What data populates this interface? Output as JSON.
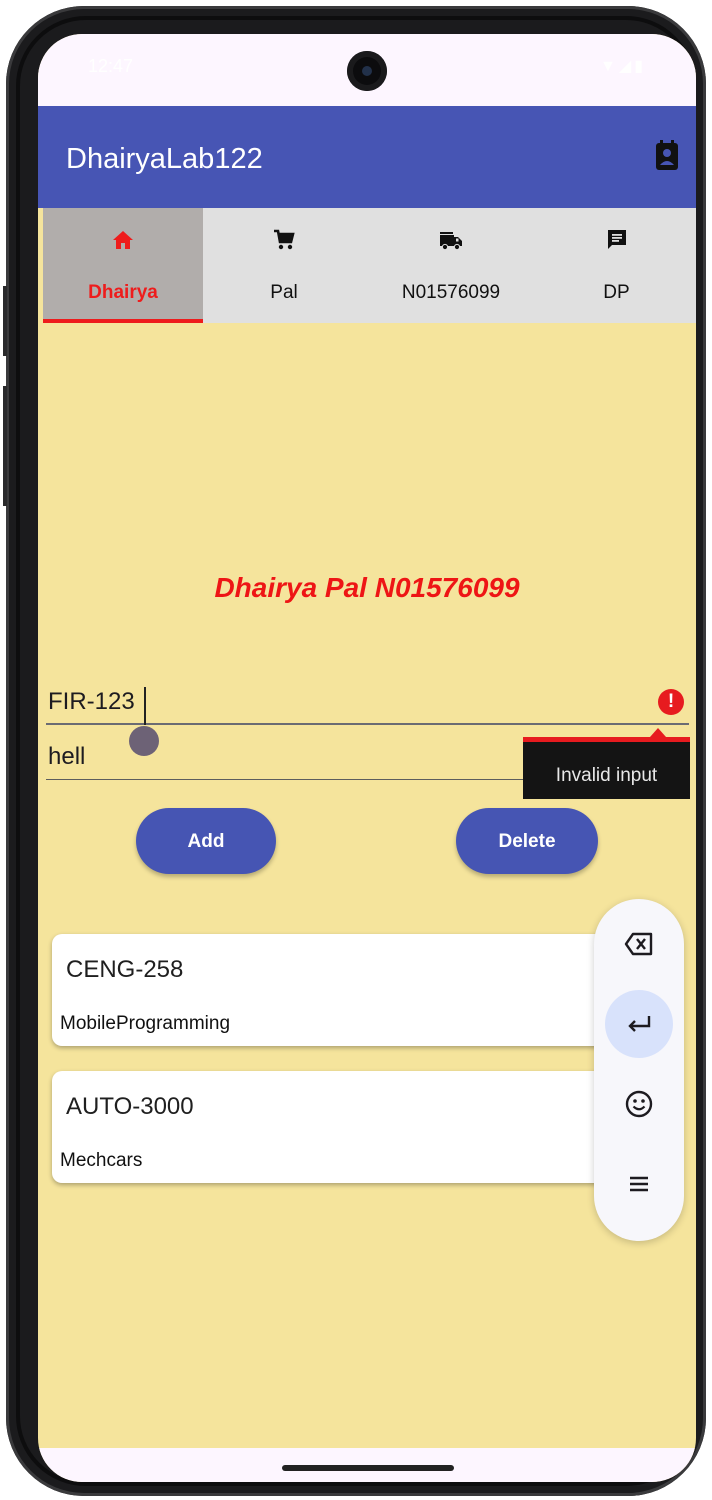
{
  "status_bar": {
    "time": "12:47",
    "icons": "▼◢▮"
  },
  "app_bar": {
    "title": "DhairyaLab122",
    "action_icon": "contact-card-icon"
  },
  "tabs": [
    {
      "label": "Dhairya",
      "icon": "home-icon",
      "active": true
    },
    {
      "label": "Pal",
      "icon": "shopping-cart-icon",
      "active": false
    },
    {
      "label": "N01576099",
      "icon": "fire-truck-icon",
      "active": false
    },
    {
      "label": "DP",
      "icon": "message-icon",
      "active": false
    }
  ],
  "headline": "Dhairya Pal N01576099",
  "form": {
    "code_value": "FIR-123",
    "name_value": "hell",
    "error_message": "Invalid input"
  },
  "buttons": {
    "add": "Add",
    "delete": "Delete"
  },
  "courses": [
    {
      "code": "CENG-258",
      "name": "MobileProgramming"
    },
    {
      "code": "AUTO-3000",
      "name": "Mechcars"
    }
  ],
  "keyboard_toolbar": [
    "backspace-icon",
    "enter-icon",
    "emoji-icon",
    "menu-icon"
  ],
  "colors": {
    "app_bar": "#4755b4",
    "background": "#f5e49c",
    "accent_red": "#ee1c1c",
    "button": "#4655b3"
  }
}
